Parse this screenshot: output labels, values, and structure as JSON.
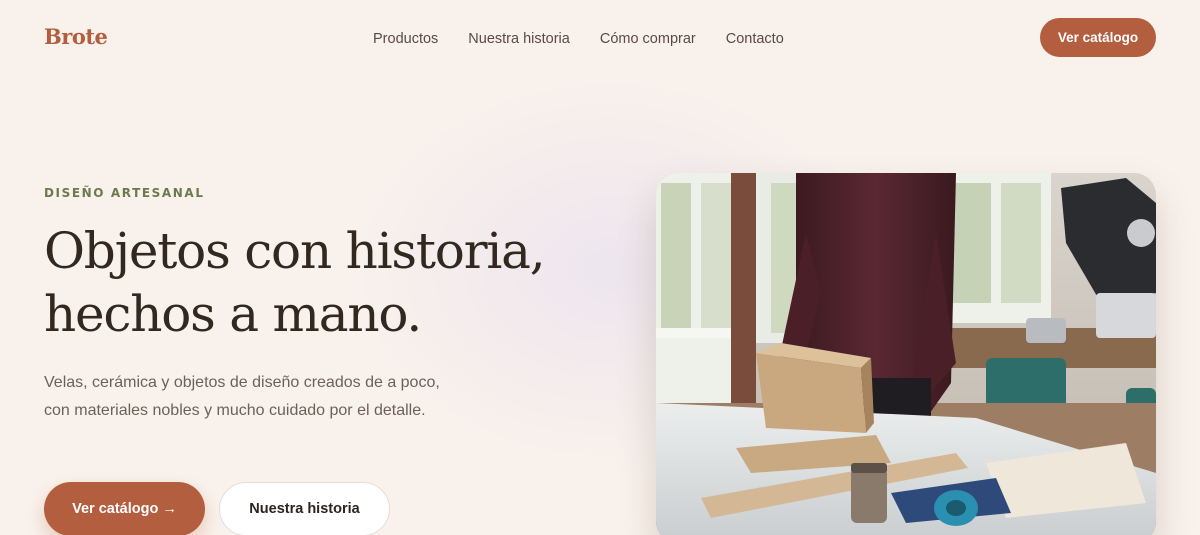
{
  "header": {
    "logo": "Brote",
    "nav": [
      {
        "label": "Productos"
      },
      {
        "label": "Nuestra historia"
      },
      {
        "label": "Cómo comprar"
      },
      {
        "label": "Contacto"
      }
    ],
    "cta_label": "Ver catálogo"
  },
  "hero": {
    "eyebrow": "DISEÑO ARTESANAL",
    "title_line1": "Objetos con historia,",
    "title_line2": "hechos a mano.",
    "description": "Velas, cerámica y objetos de diseño creados de a poco, con materiales nobles y mucho cuidado por el detalle.",
    "primary_button": "Ver catálogo →",
    "secondary_button": "Nuestra historia",
    "image_icon": "workshop-photo"
  },
  "colors": {
    "brand": "#b35e3e",
    "background": "#f9f2ec",
    "eyebrow": "#6b7a4a"
  }
}
